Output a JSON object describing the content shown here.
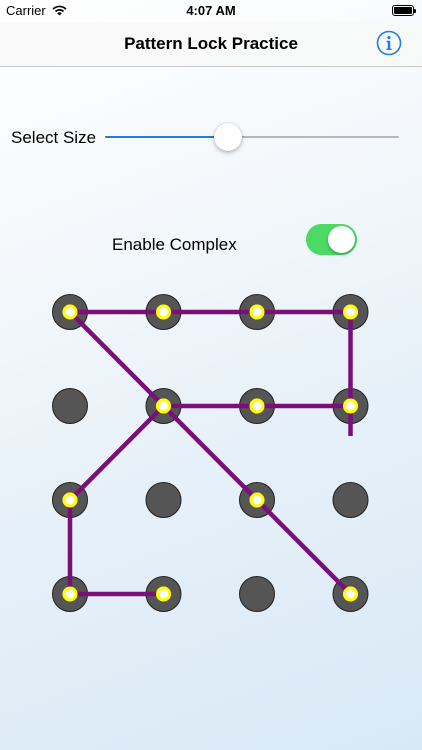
{
  "status_bar": {
    "carrier": "Carrier",
    "time": "4:07 AM",
    "wifi_icon": "wifi-icon",
    "battery_icon": "battery-icon"
  },
  "nav": {
    "title": "Pattern Lock Practice",
    "info_icon": "info-icon"
  },
  "size_slider": {
    "label": "Select Size",
    "value_fraction": 0.42
  },
  "complex_toggle": {
    "label": "Enable Complex",
    "on": true
  },
  "colors": {
    "accent_blue": "#1f7ce0",
    "toggle_on": "#4cd964",
    "dot_fill": "#555555",
    "dot_active_center": "#ffff00",
    "pattern_line": "#7a0f7a"
  },
  "pattern": {
    "rows": 4,
    "cols": 4,
    "active_dots": [
      [
        0,
        0
      ],
      [
        1,
        0
      ],
      [
        2,
        0
      ],
      [
        3,
        0
      ],
      [
        3,
        1
      ],
      [
        2,
        1
      ],
      [
        1,
        1
      ],
      [
        0,
        2
      ],
      [
        0,
        3
      ],
      [
        1,
        3
      ],
      [
        1,
        1
      ],
      [
        2,
        2
      ],
      [
        3,
        3
      ]
    ],
    "path_order": [
      [
        3,
        1
      ],
      [
        2,
        1
      ],
      [
        1,
        1
      ],
      [
        0,
        2
      ],
      [
        0,
        3
      ],
      [
        1,
        3
      ]
    ],
    "path_segments": [
      [
        [
          0,
          0
        ],
        [
          3,
          0
        ]
      ],
      [
        [
          3,
          0
        ],
        [
          3,
          1
        ]
      ],
      [
        [
          3,
          1
        ],
        [
          1,
          1
        ]
      ],
      [
        [
          0,
          0
        ],
        [
          1,
          1
        ]
      ],
      [
        [
          1,
          1
        ],
        [
          0,
          2
        ]
      ],
      [
        [
          0,
          2
        ],
        [
          0,
          3
        ]
      ],
      [
        [
          0,
          3
        ],
        [
          1,
          3
        ]
      ],
      [
        [
          1,
          1
        ],
        [
          2,
          2
        ]
      ],
      [
        [
          2,
          2
        ],
        [
          3,
          3
        ]
      ]
    ],
    "tail_end": [
      1,
      3
    ]
  }
}
